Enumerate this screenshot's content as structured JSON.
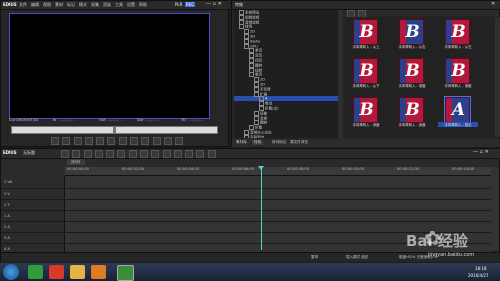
{
  "app": {
    "title": "EDIUS",
    "player_mode": "PLR",
    "rec_mode": "REC"
  },
  "menu": [
    "文件",
    "编辑",
    "视图",
    "素材",
    "标记",
    "模式",
    "采集",
    "渲染",
    "工具",
    "设置",
    "帮助"
  ],
  "player": {
    "cur": "Cur 00:00:07;01",
    "in_label": "In",
    "out_label": "Out",
    "dur_label": "Dur",
    "ttl_label": "Ttl",
    "in": "--;--;--;--",
    "out": "--;--;--;--",
    "dur": "--;--;--;--",
    "ttl": "--;--;--;--"
  },
  "effects_panel": {
    "title": "特效",
    "tree": [
      "系统预设",
      "视频滤镜",
      "音频滤镜",
      "转场",
      "2D",
      "3D",
      "Alpha",
      "GPU",
      "单页",
      "双页",
      "四页",
      "翻转",
      "扭转",
      "卷页",
      "2D",
      "3D",
      "手风琴",
      "扩展",
      "A",
      "卷动",
      "折叠(交)",
      "扭曲",
      "变换",
      "翻转",
      "折叠",
      "音频淡入淡出",
      "字幕混合"
    ],
    "tiles": [
      {
        "letter": "B",
        "caption": "手风琴转入 - 从上",
        "selected": false,
        "style": "red"
      },
      {
        "letter": "B",
        "caption": "手风琴转入 - 从右",
        "selected": false,
        "style": "blue"
      },
      {
        "letter": "B",
        "caption": "手风琴转入 - 从左",
        "selected": false,
        "style": "red"
      },
      {
        "letter": "B",
        "caption": "手风琴转入 - 从下",
        "selected": false,
        "style": "red"
      },
      {
        "letter": "B",
        "caption": "手风琴转入 - 深度",
        "selected": false,
        "style": "red"
      },
      {
        "letter": "B",
        "caption": "手风琴转入 - 深度",
        "selected": false,
        "style": "red"
      },
      {
        "letter": "B",
        "caption": "手风琴转入 - 深度",
        "selected": false,
        "style": "red"
      },
      {
        "letter": "B",
        "caption": "手风琴转入 - 深度",
        "selected": false,
        "style": "red"
      },
      {
        "letter": "A",
        "caption": "手风琴转入 - 扭出",
        "selected": true,
        "style": "blue"
      }
    ],
    "tabs": [
      "素材库",
      "特效",
      "序列标记",
      "源文件浏览"
    ]
  },
  "timeline": {
    "app_label": "EDIUS",
    "project": "无标题",
    "sequence": "序列1",
    "times": [
      "00:00:00;00",
      "00:00:02;00",
      "00:00:04;00",
      "00:00:06;00",
      "00:00:08;00",
      "00:00:10;00",
      "00:00:12;00",
      "00:00:14;00"
    ],
    "tracks": [
      {
        "name": "1 VA",
        "type": "video"
      },
      {
        "name": "1 V",
        "type": "video"
      },
      {
        "name": "1 T",
        "type": "title"
      },
      {
        "name": "1 A",
        "type": "audio"
      },
      {
        "name": "2 A",
        "type": "audio"
      },
      {
        "name": "3 A",
        "type": "audio"
      },
      {
        "name": "4 A",
        "type": "audio"
      }
    ],
    "status": [
      "暂停",
      "插入模式",
      "波纹",
      "磁盘:62% 已被使用(C:)"
    ]
  },
  "taskbar": {
    "time": "18:18",
    "date": "2016/4/27"
  },
  "watermark": {
    "text": "Bai 经验",
    "url": "jingyan.baidu.com"
  },
  "colors": {
    "accent": "#3f78ff",
    "tile_red": "#b2183a",
    "tile_blue": "#2d3e8a",
    "playhead": "#5ad0c8"
  }
}
